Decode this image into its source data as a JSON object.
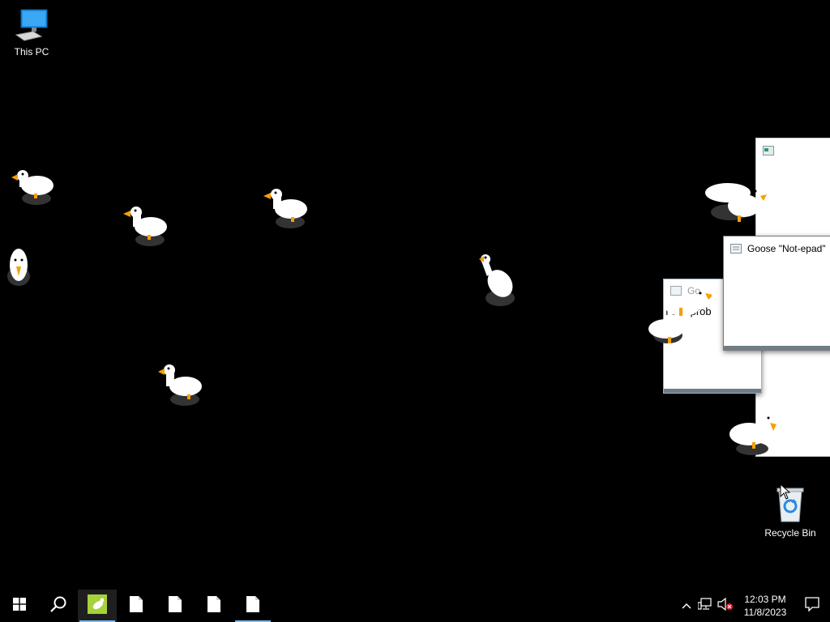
{
  "desktop": {
    "icons": [
      {
        "label": "This PC",
        "icon": "computer-icon"
      },
      {
        "label": "Recycle Bin",
        "icon": "recycle-bin-icon"
      }
    ]
  },
  "windows": {
    "notepad_top": {
      "title": "Goose \"Not-epad\"",
      "icon": "notepad-icon"
    },
    "notepad_back": {
      "title_partial": "Go",
      "body_partial_left": "I ca",
      "body_partial_right": "prob"
    },
    "notepad_rear": {
      "icon": "notepad-icon"
    }
  },
  "taskbar": {
    "items": [
      {
        "name": "start",
        "icon": "windows-start-icon"
      },
      {
        "name": "search",
        "icon": "search-icon"
      },
      {
        "name": "desktop-goose",
        "icon": "goose-app-icon",
        "active": true
      },
      {
        "name": "notepad-1",
        "icon": "document-icon"
      },
      {
        "name": "notepad-2",
        "icon": "document-icon"
      },
      {
        "name": "notepad-3",
        "icon": "document-icon"
      },
      {
        "name": "notepad-4",
        "icon": "document-icon",
        "active": true
      }
    ],
    "tray": {
      "icons": [
        "chevron-up-icon",
        "network-icon",
        "volume-muted-icon",
        "notification-icon"
      ],
      "time": "12:03 PM",
      "date": "11/8/2023"
    }
  },
  "colors": {
    "accent": "#76b9ed",
    "goose_beak": "#f5a000",
    "desktop_bg": "#000000"
  }
}
